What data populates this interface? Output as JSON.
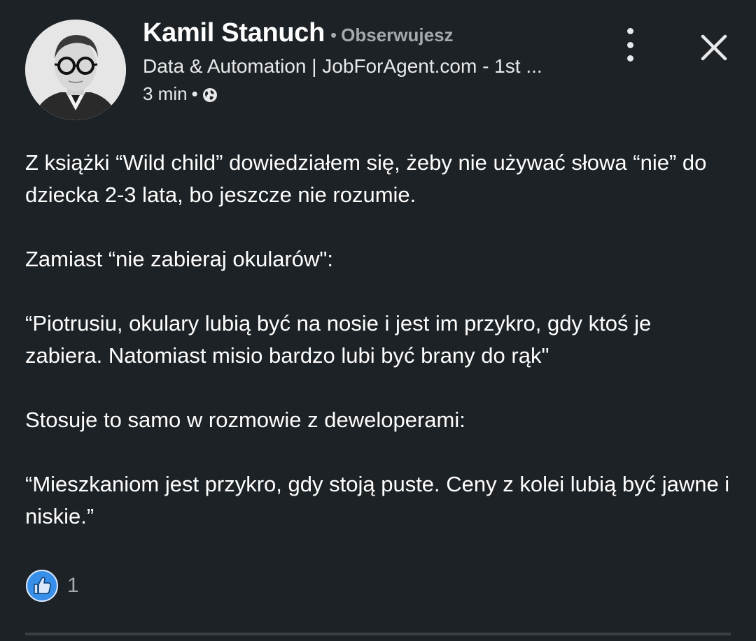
{
  "author": {
    "name": "Kamil Stanuch",
    "follow_status": "Obserwujesz",
    "headline": "Data & Automation | JobForAgent.com - 1st ...",
    "time": "3 min",
    "visibility_icon": "globe-icon"
  },
  "header_actions": {
    "more_icon": "more-vertical-icon",
    "close_icon": "close-icon"
  },
  "body": {
    "paragraphs": [
      "Z książki “Wild child” dowiedziałem się, żeby nie używać słowa “nie” do dziecka 2-3 lata, bo jeszcze nie rozumie.",
      "Zamiast “nie zabieraj okularów\":",
      "“Piotrusiu, okulary lubią być na nosie i jest im przykro, gdy ktoś je zabiera. Natomiast misio bardzo lubi być brany do rąk\"",
      "Stosuje to samo w rozmowie z deweloperami:",
      "“Mieszkaniom jest przykro, gdy stoją puste. Ceny z kolei lubią być jawne i niskie.”"
    ]
  },
  "reactions": {
    "icon": "like-icon",
    "count": "1"
  },
  "colors": {
    "background": "#1d2226",
    "text_primary": "#ffffff",
    "text_secondary": "#a6a9ab",
    "like_blue": "#378fe9"
  }
}
